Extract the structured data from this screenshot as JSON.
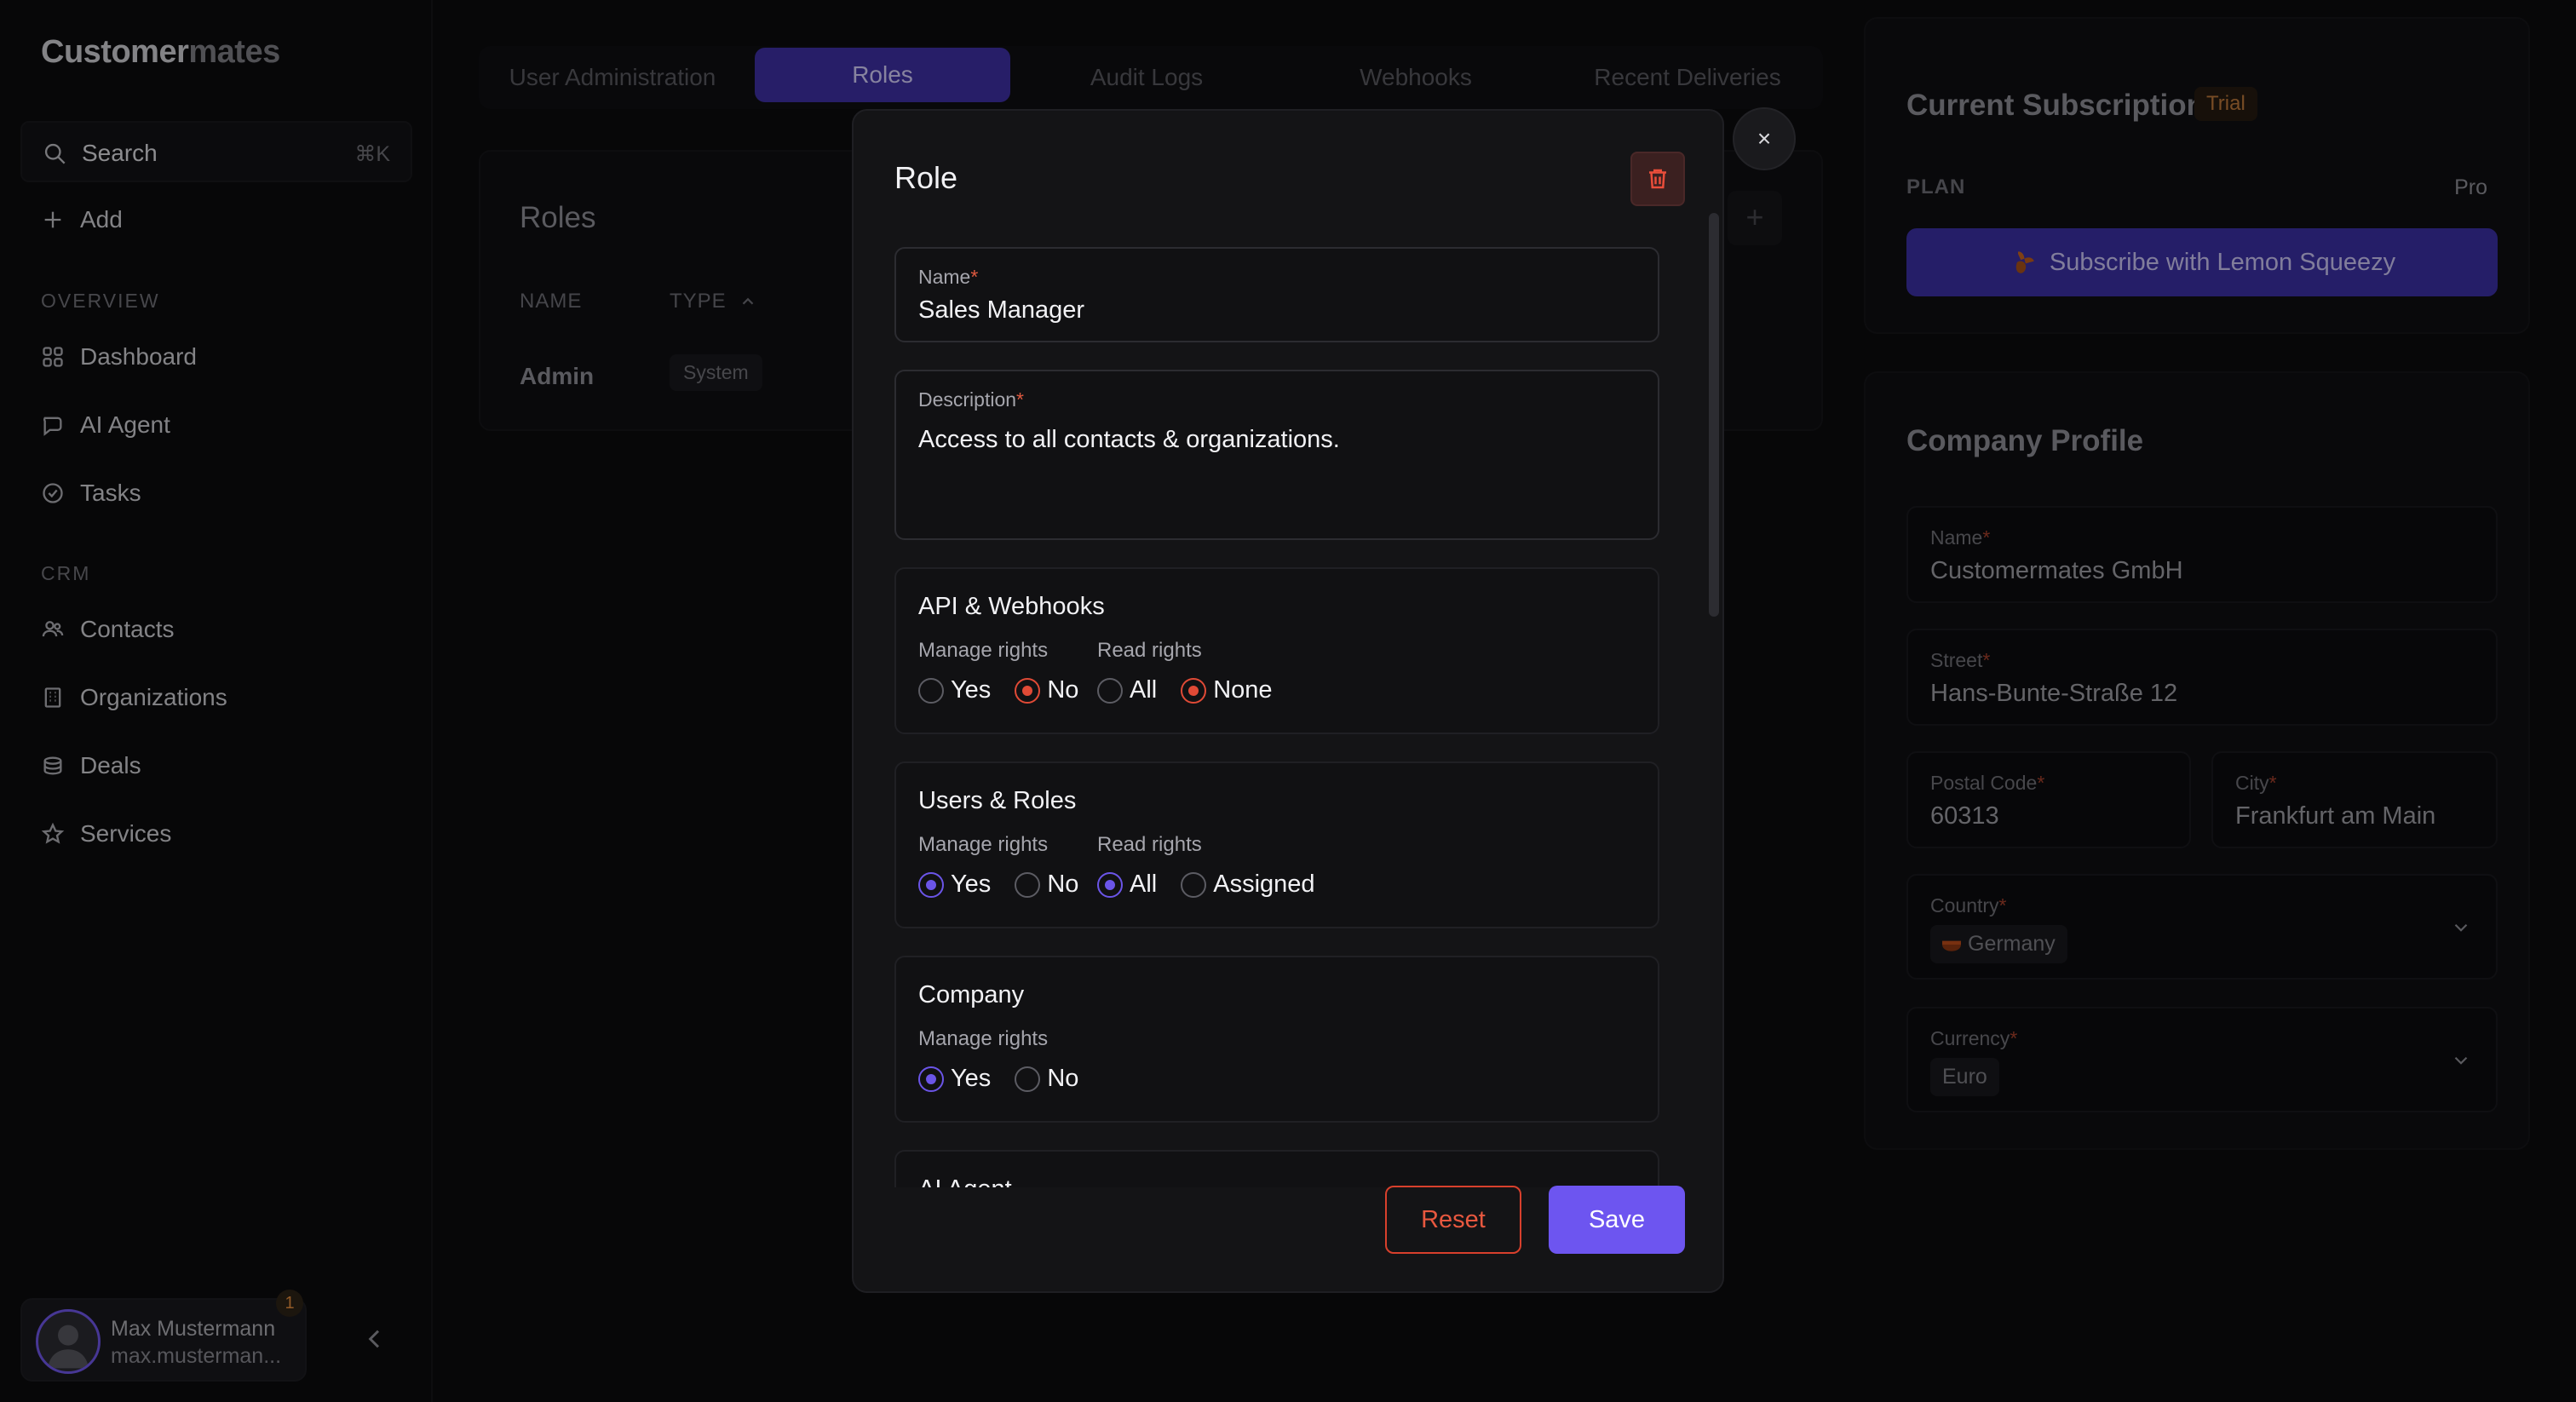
{
  "app": {
    "logo_part1": "Customer",
    "logo_part2": "mates"
  },
  "sidebar": {
    "search_label": "Search",
    "search_shortcut": "⌘K",
    "add_label": "Add",
    "section_overview": "OVERVIEW",
    "section_crm": "CRM",
    "items": [
      {
        "label": "Dashboard",
        "icon": "dashboard-icon"
      },
      {
        "label": "AI Agent",
        "icon": "chat-icon"
      },
      {
        "label": "Tasks",
        "icon": "check-circle-icon"
      },
      {
        "label": "Contacts",
        "icon": "contacts-icon"
      },
      {
        "label": "Organizations",
        "icon": "building-icon"
      },
      {
        "label": "Deals",
        "icon": "deals-icon"
      },
      {
        "label": "Services",
        "icon": "star-icon"
      }
    ],
    "user": {
      "name": "Max Mustermann",
      "email": "max.musterman...",
      "notifications": "1"
    }
  },
  "tabs": [
    "User Administration",
    "Roles",
    "Audit Logs",
    "Webhooks",
    "Recent Deliveries"
  ],
  "roles_panel": {
    "title": "Roles",
    "col_name": "NAME",
    "col_type": "TYPE",
    "rows": [
      {
        "name": "Admin",
        "type": "System"
      }
    ]
  },
  "subscription": {
    "title": "Current Subscription",
    "badge": "Trial",
    "plan_label": "PLAN",
    "plan_value": "Pro",
    "subscribe_label": "Subscribe with Lemon Squeezy"
  },
  "company": {
    "title": "Company Profile",
    "name_label": "Name",
    "name_value": "Customermates GmbH",
    "street_label": "Street",
    "street_value": "Hans-Bunte-Straße 12",
    "postal_label": "Postal Code",
    "postal_value": "60313",
    "city_label": "City",
    "city_value": "Frankfurt am Main",
    "country_label": "Country",
    "country_value": "Germany",
    "currency_label": "Currency",
    "currency_value": "Euro"
  },
  "modal": {
    "title": "Role",
    "name_label": "Name",
    "name_value": "Sales Manager",
    "desc_label": "Description",
    "desc_value": "Access to all contacts & organizations.",
    "api": {
      "title": "API & Webhooks",
      "manage_label": "Manage rights",
      "read_label": "Read rights",
      "manage_opts": [
        "Yes",
        "No"
      ],
      "read_opts": [
        "All",
        "None"
      ]
    },
    "users": {
      "title": "Users & Roles",
      "manage_label": "Manage rights",
      "read_label": "Read rights",
      "manage_opts": [
        "Yes",
        "No"
      ],
      "read_opts": [
        "All",
        "Assigned"
      ]
    },
    "company_perm": {
      "title": "Company",
      "manage_label": "Manage rights",
      "manage_opts": [
        "Yes",
        "No"
      ]
    },
    "next_section": "AI Agent",
    "reset_label": "Reset",
    "save_label": "Save",
    "close_label": "×"
  },
  "colors": {
    "accent": "#6d55f0",
    "danger": "#e04a36",
    "background": "#0b0b0d"
  }
}
